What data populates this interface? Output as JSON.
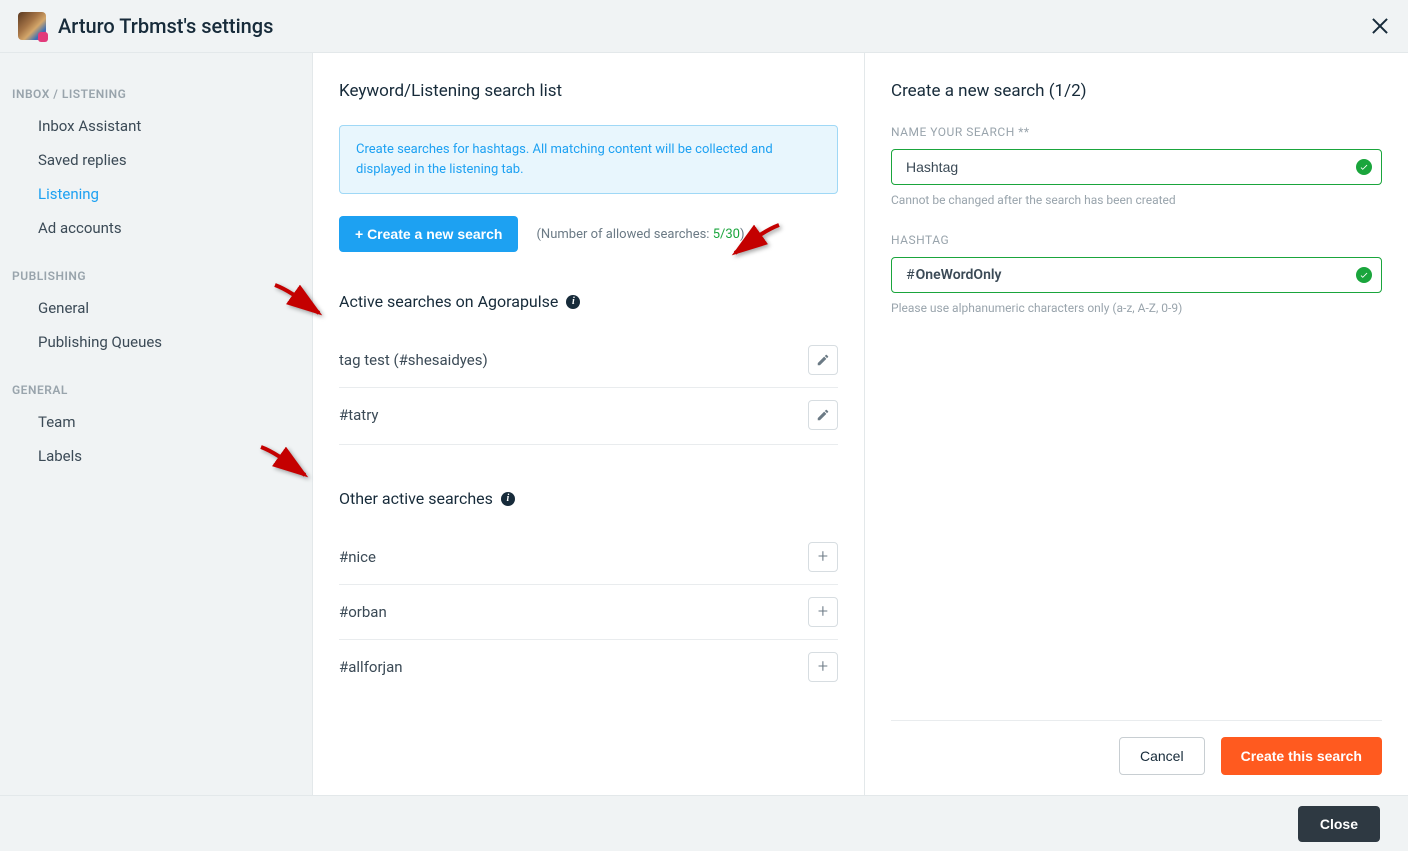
{
  "header": {
    "title": "Arturo Trbmst's settings"
  },
  "sidebar": {
    "categories": [
      {
        "label": "INBOX / LISTENING",
        "items": [
          {
            "label": "Inbox Assistant",
            "active": false
          },
          {
            "label": "Saved replies",
            "active": false
          },
          {
            "label": "Listening",
            "active": true
          },
          {
            "label": "Ad accounts",
            "active": false
          }
        ]
      },
      {
        "label": "PUBLISHING",
        "items": [
          {
            "label": "General",
            "active": false
          },
          {
            "label": "Publishing Queues",
            "active": false
          }
        ]
      },
      {
        "label": "GENERAL",
        "items": [
          {
            "label": "Team",
            "active": false
          },
          {
            "label": "Labels",
            "active": false
          }
        ]
      }
    ]
  },
  "center": {
    "title": "Keyword/Listening search list",
    "info": "Create searches for hashtags. All matching content will be collected and displayed in the listening tab.",
    "create_button": "+ Create a new search",
    "allowed_prefix": "(Number of allowed searches: ",
    "allowed_count": "5/30",
    "allowed_suffix": ")",
    "active_title": "Active searches on Agorapulse",
    "active_searches": [
      {
        "label": "tag test (#shesaidyes)"
      },
      {
        "label": "#tatry"
      }
    ],
    "other_title": "Other active searches",
    "other_searches": [
      {
        "label": "#nice"
      },
      {
        "label": "#orban"
      },
      {
        "label": "#allforjan"
      }
    ]
  },
  "right": {
    "title": "Create a new search (1/2)",
    "name_label": "NAME YOUR SEARCH **",
    "name_value": "Hashtag",
    "name_helper": "Cannot be changed after the search has been created",
    "hashtag_label": "HASHTAG",
    "hashtag_prefix": "#",
    "hashtag_value": "OneWordOnly",
    "hashtag_helper": "Please use alphanumeric characters only (a-z, A-Z, 0-9)",
    "cancel": "Cancel",
    "create": "Create this search"
  },
  "footer": {
    "close": "Close"
  }
}
